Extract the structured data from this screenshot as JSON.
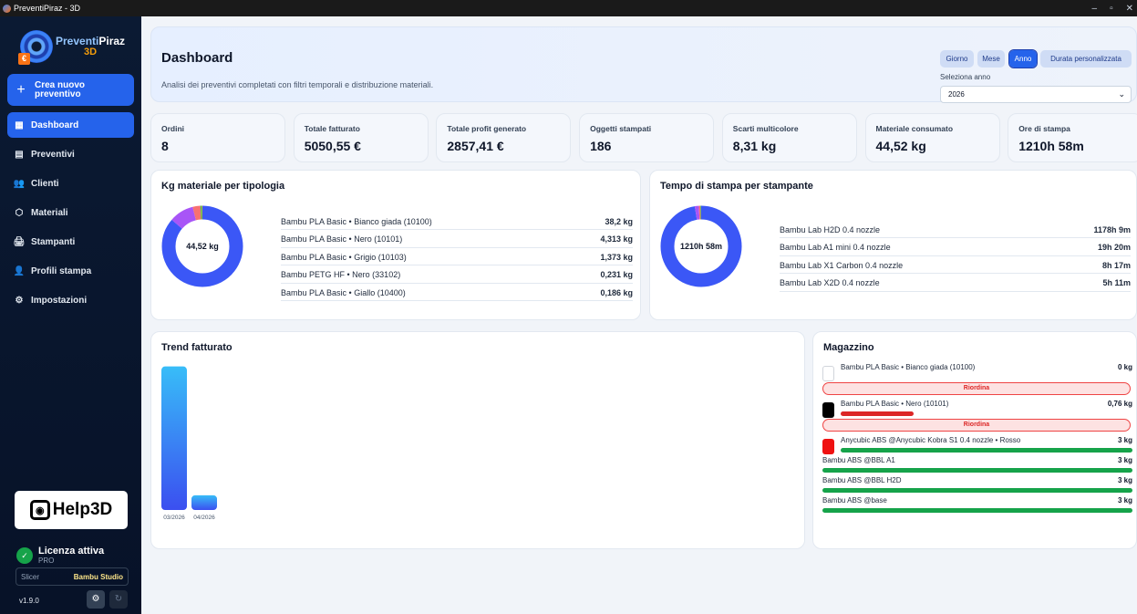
{
  "window": {
    "title": "PreventiPiraz - 3D",
    "min": "–",
    "max": "▫",
    "close": "✕"
  },
  "brand": {
    "name_a": "Preventi",
    "name_b": "Piraz",
    "name_c": "3D",
    "badge": "€"
  },
  "sidebar": {
    "new_button": "Crea nuovo preventivo",
    "items": [
      {
        "label": "Dashboard",
        "icon": "▦",
        "active": true
      },
      {
        "label": "Preventivi",
        "icon": "▤"
      },
      {
        "label": "Clienti",
        "icon": "👥"
      },
      {
        "label": "Materiali",
        "icon": "⬡"
      },
      {
        "label": "Stampanti",
        "icon": "🖨"
      },
      {
        "label": "Profili stampa",
        "icon": "👤"
      },
      {
        "label": "Impostazioni",
        "icon": "⚙"
      }
    ],
    "help_logo": "Help3D",
    "license_title": "Licenza attiva",
    "license_sub": "PRO",
    "slicer_label": "Slicer",
    "slicer_value": "Bambu Studio",
    "version": "v1.9.0"
  },
  "header": {
    "title": "Dashboard",
    "subtitle": "Analisi dei preventivi completati con filtri temporali e distribuzione materiali.",
    "segments": [
      "Giorno",
      "Mese",
      "Anno",
      "Durata personalizzata"
    ],
    "segment_selected": "Anno",
    "select_label": "Seleziona anno",
    "select_value": "2026"
  },
  "stats": [
    {
      "label": "Ordini",
      "value": "8"
    },
    {
      "label": "Totale fatturato",
      "value": "5050,55 €"
    },
    {
      "label": "Totale profit generato",
      "value": "2857,41 €"
    },
    {
      "label": "Oggetti stampati",
      "value": "186"
    },
    {
      "label": "Scarti multicolore",
      "value": "8,31 kg"
    },
    {
      "label": "Materiale consumato",
      "value": "44,52 kg"
    },
    {
      "label": "Ore di stampa",
      "value": "1210h 58m"
    }
  ],
  "materials": {
    "title": "Kg materiale per tipologia",
    "center": "44,52 kg",
    "rows": [
      {
        "name": "Bambu PLA Basic • Bianco giada (10100)",
        "value": "38,2 kg"
      },
      {
        "name": "Bambu PLA Basic • Nero (10101)",
        "value": "4,313 kg"
      },
      {
        "name": "Bambu PLA Basic • Grigio (10103)",
        "value": "1,373 kg"
      },
      {
        "name": "Bambu PETG HF • Nero (33102)",
        "value": "0,231 kg"
      },
      {
        "name": "Bambu PLA Basic • Giallo (10400)",
        "value": "0,186 kg"
      }
    ]
  },
  "printers": {
    "title": "Tempo di stampa per stampante",
    "center": "1210h 58m",
    "rows": [
      {
        "name": "Bambu Lab H2D 0.4 nozzle",
        "value": "1178h 9m"
      },
      {
        "name": "Bambu Lab A1 mini 0.4 nozzle",
        "value": "19h 20m"
      },
      {
        "name": "Bambu Lab X1 Carbon 0.4 nozzle",
        "value": "8h 17m"
      },
      {
        "name": "Bambu Lab X2D 0.4 nozzle",
        "value": "5h 11m"
      }
    ]
  },
  "chart_data": {
    "type": "bar",
    "title": "Trend fatturato",
    "categories": [
      "03/2026",
      "04/2026"
    ],
    "values": [
      4580,
      470
    ],
    "ylim": [
      0,
      4600
    ],
    "grid": false
  },
  "warehouse": {
    "title": "Magazzino",
    "reorder_label": "Riordina",
    "items": [
      {
        "name": "Bambu PLA Basic • Bianco giada (10100)",
        "value": "0 kg",
        "swatch": "#ffffff",
        "level": 0
      },
      {
        "name": "Bambu PLA Basic • Nero (10101)",
        "value": "0,76 kg",
        "swatch": "#000000",
        "level": 0.25
      },
      {
        "name": "Anycubic ABS @Anycubic Kobra S1 0.4 nozzle • Rosso",
        "value": "3 kg",
        "swatch": "#ef1111",
        "level": 1
      },
      {
        "name": "Bambu ABS @BBL A1",
        "value": "3 kg",
        "level": 1
      },
      {
        "name": "Bambu ABS @BBL H2D",
        "value": "3 kg",
        "level": 1
      },
      {
        "name": "Bambu ABS @base",
        "value": "3 kg",
        "level": 1
      }
    ]
  },
  "colors": {
    "accent": "#2563eb",
    "sidebar": "#0b1a33",
    "ok": "#16a34a",
    "warn": "#dc2626"
  }
}
